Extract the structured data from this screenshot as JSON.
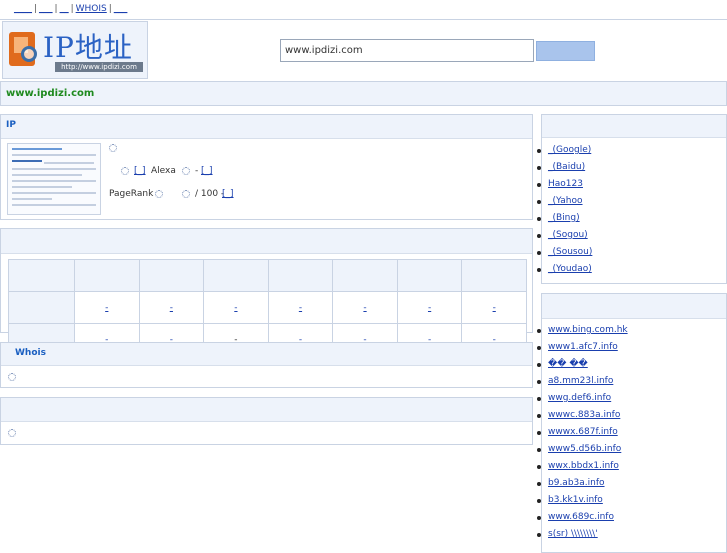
{
  "nav": {
    "items": [
      "____",
      "___",
      "__",
      "WHOIS",
      "___"
    ]
  },
  "logo": {
    "title": "IP地址",
    "url": "http://www.ipdizi.com"
  },
  "search": {
    "value": "www.ipdizi.com"
  },
  "domain": {
    "title": "www.ipdizi.com"
  },
  "ip_panel": {
    "title": "IP",
    "row2": {
      "link1": "[_]",
      "alexa_label": "Alexa",
      "dash": "-",
      "link2": "[_]"
    },
    "row3": {
      "pagerank_label": "PageRank",
      "score": "/ 100 -",
      "link": "[_]"
    }
  },
  "rank_table": {
    "rows": [
      [
        "-",
        "-",
        "-",
        "-",
        "-",
        "-",
        "-"
      ],
      [
        "-",
        "-",
        "-",
        "-",
        "-",
        "-",
        "-"
      ]
    ]
  },
  "whois_panel": {
    "title": "Whois"
  },
  "engines": {
    "items": [
      "_(Google)",
      "_(Baidu)",
      "Hao123",
      "_(Yahoo",
      "_(Bing)",
      "_(Sogou)",
      "_(Sousou)",
      "_(Youdao)"
    ]
  },
  "sites": {
    "items": [
      "www.bing.com.hk",
      "www1.afc7.info",
      "�� ��",
      "a8.mm23l.info",
      "wwg.def6.info",
      "wwwc.883a.info",
      "wwwx.687f.info",
      "www5.d56b.info",
      "wwx.bbdx1.info",
      "b9.ab3a.info",
      "b3.kk1v.info",
      "www.689c.info",
      "s(sr) \\\\\\\\\\\\\\\\'"
    ]
  },
  "colors": {
    "link": "#1a3fae",
    "panel_header": "#eef3fb",
    "border": "#c9d3e3",
    "domain_green": "#1f8a1f",
    "title_blue": "#1a5fc1"
  }
}
